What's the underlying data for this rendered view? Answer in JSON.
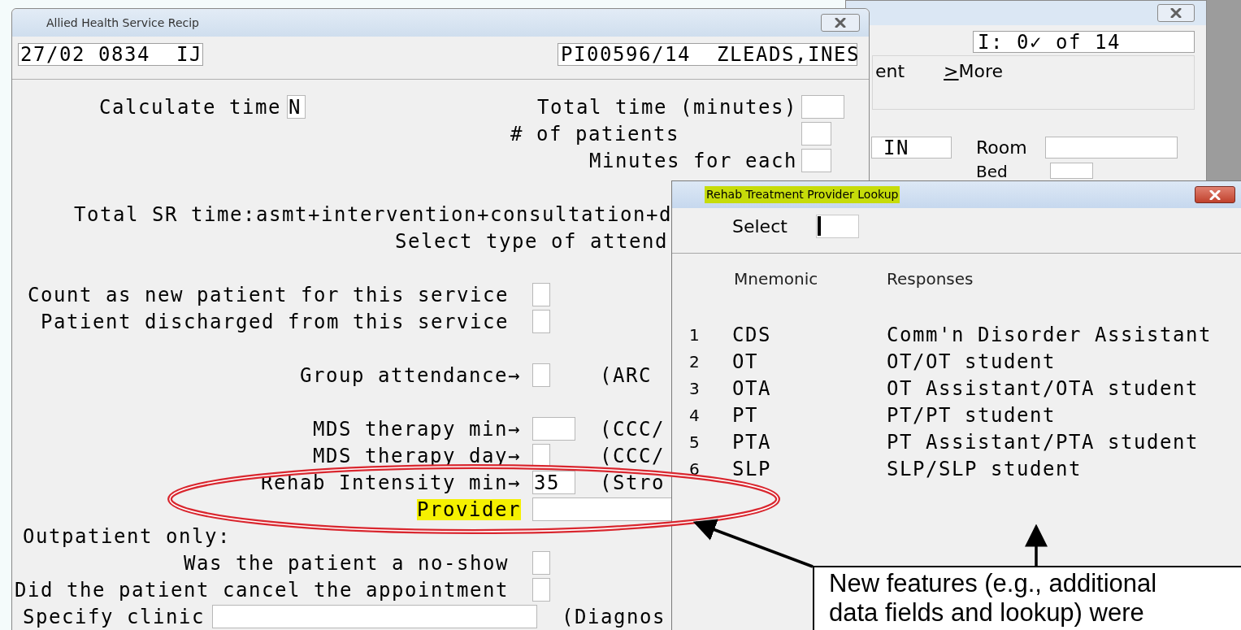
{
  "back_window": {
    "counter": "I: 0✓ of 14",
    "panel_text": "ent",
    "more_link": ">More",
    "field_value": "IN",
    "room_label": "Room",
    "bed_label": "Bed"
  },
  "main_window": {
    "title": "Allied Health Service Recip",
    "header_left": "27/02 0834  IJ",
    "header_right": "PI00596/14  ZLEADS,INES",
    "sections": [
      [
        {
          "kind": "calc",
          "label": "Calculate time",
          "value": "N",
          "aside_label": "Total time (minutes)"
        },
        {
          "kind": "patients",
          "label": "# of patients"
        },
        {
          "kind": "minutes",
          "label": "Minutes for each"
        }
      ],
      [
        {
          "kind": "wide_text",
          "label": "Total SR time:asmt+intervention+consultation+d"
        },
        {
          "kind": "mid_text",
          "label": "Select type of attend"
        }
      ],
      [
        {
          "kind": "flag",
          "label": "Count as new patient for this service",
          "checked": false
        },
        {
          "kind": "flag",
          "label": "Patient discharged from this service",
          "checked": false
        }
      ],
      [
        {
          "kind": "arrow_char",
          "label": "Group attendance→",
          "note": "(ARC"
        }
      ],
      [
        {
          "kind": "arrow_num",
          "label": "MDS therapy min→",
          "note": "(CCC/"
        },
        {
          "kind": "arrow_char",
          "label": "MDS therapy day→",
          "note": "(CCC/"
        },
        {
          "kind": "arrow_num",
          "label": "Rehab Intensity min→",
          "value": "35",
          "note": "(Stro"
        },
        {
          "kind": "arrow_wide",
          "label": "Provider",
          "highlighted": true
        },
        {
          "kind": "left_text",
          "label": "Outpatient only:"
        },
        {
          "kind": "flag",
          "label": "Was the patient a no-show",
          "checked": false
        },
        {
          "kind": "flag",
          "label": "Did the patient cancel the appointment",
          "checked": false
        },
        {
          "kind": "clinic",
          "label": "Specify clinic",
          "note": "(Diagnos"
        }
      ]
    ]
  },
  "lookup": {
    "title": "Rehab Treatment Provider Lookup",
    "title_highlighted": true,
    "select_label": "Select",
    "columns": [
      "Mnemonic",
      "Responses"
    ],
    "rows": [
      {
        "number": "1",
        "mnemonic": "CDS",
        "response": "Comm'n Disorder Assistant"
      },
      {
        "number": "2",
        "mnemonic": "OT",
        "response": "OT/OT student"
      },
      {
        "number": "3",
        "mnemonic": "OTA",
        "response": "OT Assistant/OTA student"
      },
      {
        "number": "4",
        "mnemonic": "PT",
        "response": "PT/PT student"
      },
      {
        "number": "5",
        "mnemonic": "PTA",
        "response": "PT Assistant/PTA student"
      },
      {
        "number": "6",
        "mnemonic": "SLP",
        "response": "SLP/SLP student"
      }
    ]
  },
  "callout": {
    "text": "New features (e.g., additional data fields and lookup) were"
  }
}
